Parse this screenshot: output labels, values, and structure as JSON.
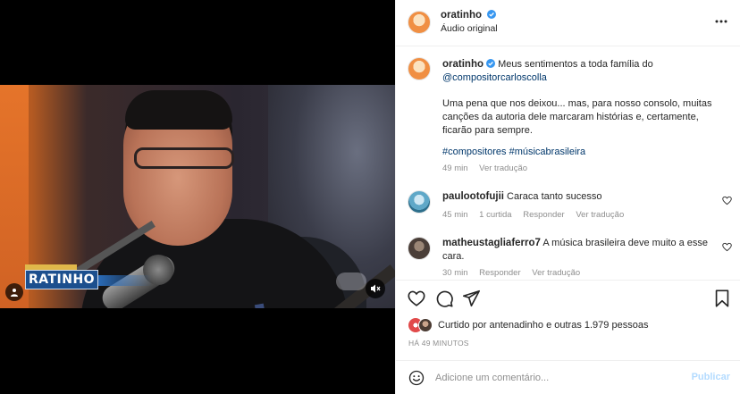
{
  "post": {
    "username": "oratinho",
    "audio": "Áudio original"
  },
  "media": {
    "logo_text": "RATINHO",
    "icons": {
      "user_tag": "user-icon",
      "mute": "speaker-muted-icon"
    }
  },
  "caption": {
    "username": "oratinho",
    "line1_prefix": "Meus sentimentos a toda família do",
    "mention": "@compositorcarloscolla",
    "paragraph": "Uma pena que nos deixou... mas, para nosso consolo, muitas canções da autoria dele marcaram histórias e, certamente, ficarão para sempre.",
    "hashtags": "#compositores #músicabrasileira",
    "time": "49 min",
    "translate": "Ver tradução"
  },
  "comments": [
    {
      "username": "paulootofujii",
      "text": "Caraca tanto sucesso",
      "time": "45 min",
      "likes": "1 curtida",
      "reply": "Responder",
      "translate": "Ver tradução"
    },
    {
      "username": "matheustagliaferro7",
      "text": "A música brasileira deve muito a esse cara.",
      "time": "30 min",
      "reply": "Responder",
      "translate": "Ver tradução"
    }
  ],
  "likes": {
    "text": "Curtido por antenadinho e outras 1.979 pessoas"
  },
  "time_ago": "HÁ 49 MINUTOS",
  "comment_box": {
    "placeholder": "Adicione um comentário...",
    "publish": "Publicar"
  },
  "colors": {
    "link": "#00376b",
    "verified": "#3897f0",
    "muted": "#8e8e8e",
    "publish_disabled": "#b3dbff"
  }
}
